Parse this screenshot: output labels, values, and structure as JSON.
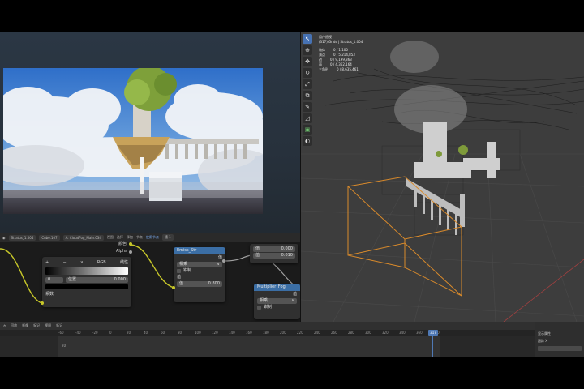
{
  "node_editor": {
    "header": {
      "object": "Stratus_1.004",
      "material": "Cube.107",
      "node_group": "A: CloudFog_Main.034",
      "menus": [
        "视图",
        "选择",
        "添加",
        "节点"
      ],
      "use_nodes": "使用节点",
      "slot": "槽 1"
    },
    "color_ramp": {
      "mode": "RGB",
      "interpolation": "线性",
      "index": "0",
      "position_label": "位置",
      "position_value": "0.000",
      "output_factor": "系数"
    },
    "group_node": {
      "name": "A: CloudFog_Main.034",
      "color_out": "颜色",
      "alpha_out": "Alpha"
    },
    "math_node_1": {
      "title": "Emiss_Str",
      "out": "值",
      "op": "相乘",
      "clamp": "钳制",
      "in_label": "值",
      "value_label": "值",
      "value": "0.800"
    },
    "value_fields": {
      "a_label": "值",
      "a": "0.000",
      "b_label": "值",
      "b": "0.010"
    },
    "math_node_2": {
      "title": "Multiplier_Fog",
      "out": "值",
      "op": "相乘",
      "clamp": "钳制"
    }
  },
  "viewport": {
    "view_name": "用户透视",
    "collection": "(317) Grids | Stratus_1.004",
    "stats": [
      {
        "label": "物体",
        "value": "0 / 1,100"
      },
      {
        "label": "顶点",
        "value": "0 / 5,214,853"
      },
      {
        "label": "边",
        "value": "0 / 9,199,363"
      },
      {
        "label": "面",
        "value": "0 / 4,362,164"
      },
      {
        "label": "三角形",
        "value": "0 / 8,635,461"
      }
    ],
    "tools": [
      "select-icon",
      "cursor-icon",
      "move-icon",
      "rotate-icon",
      "scale-icon",
      "transform-icon",
      "annotate-icon",
      "measure-icon",
      "add-cube-icon",
      "extra-icon"
    ]
  },
  "timeline": {
    "menus": [
      "回放",
      "抠像",
      "标记",
      "视图",
      "标记"
    ],
    "ruler_numbers": [
      "-60",
      "-40",
      "-20",
      "0",
      "20",
      "40",
      "60",
      "80",
      "100",
      "120",
      "140",
      "160",
      "180",
      "200",
      "220",
      "240",
      "260",
      "280",
      "300",
      "320",
      "340",
      "360",
      "380"
    ],
    "current_frame": "317",
    "key_label": "20",
    "side_title": "显示属性",
    "side_label": "跟踪 X"
  },
  "colors": {
    "accent_blue": "#4772b3",
    "node_header_blue": "#3b6ea5",
    "wire_yellow": "#c7c729",
    "bounds_orange": "#d98a2b"
  }
}
